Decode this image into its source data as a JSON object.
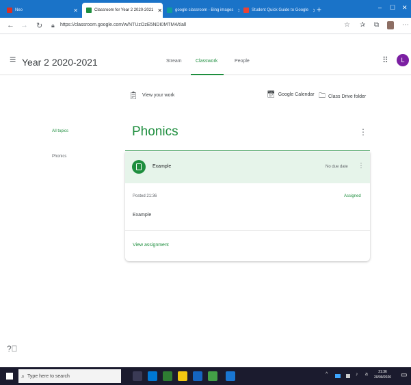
{
  "browser": {
    "tabs": [
      {
        "label": "Neo",
        "icon": "office-icon",
        "color": "#d93025",
        "active": false
      },
      {
        "label": "Classroom for Year 2 2020-2021",
        "icon": "classroom-icon",
        "color": "#1e8e3e",
        "active": true
      },
      {
        "label": "google classroom - Bing images",
        "icon": "bing-icon",
        "color": "#0f9d9a",
        "active": false
      },
      {
        "label": "Student Quick Guide to Google",
        "icon": "doc-icon",
        "color": "#ea4335",
        "active": false
      }
    ],
    "new_tab": "+",
    "window_controls": [
      "–",
      "☐",
      "✕"
    ],
    "url": "https://classroom.google.com/w/NTUzOzE5NDI0MTM4/t/all"
  },
  "header": {
    "menu_icon": "hamburger-icon",
    "class_title": "Year 2 2020-2021",
    "tabs": [
      {
        "label": "Stream",
        "active": false
      },
      {
        "label": "Classwork",
        "active": true
      },
      {
        "label": "People",
        "active": false
      }
    ],
    "avatar_letter": "L",
    "avatar_color": "#7b1fa2"
  },
  "workbar": {
    "view_your_work": "View your work",
    "google_calendar": "Google Calendar",
    "class_drive_folder": "Class Drive folder"
  },
  "sidebar": {
    "items": [
      {
        "label": "All topics",
        "selected": true
      },
      {
        "label": "Phonics",
        "selected": false
      }
    ]
  },
  "topic": {
    "title": "Phonics",
    "accent": "#1e8e3e"
  },
  "assignment": {
    "title": "Example",
    "due": "No due date",
    "posted": "Posted 21:36",
    "status": "Assigned",
    "description": "Example",
    "view_link": "View assignment"
  },
  "taskbar": {
    "search_placeholder": "Type here to search",
    "time": "21:36",
    "date": "20/09/2020"
  }
}
